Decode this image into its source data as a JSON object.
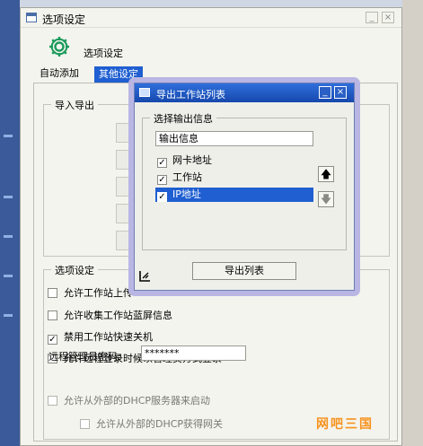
{
  "main_window": {
    "title": "选项设定",
    "header_label": "选项设定",
    "tabs": [
      {
        "label": "自动添加",
        "active": false
      },
      {
        "label": "其他设定",
        "active": true
      }
    ]
  },
  "import_export": {
    "title": "导入导出"
  },
  "options": {
    "title": "选项设定",
    "items": [
      {
        "label": "允许工作站上传",
        "checked": false,
        "enabled": true
      },
      {
        "label": "允许收集工作站蓝屏信息",
        "checked": false,
        "enabled": true
      },
      {
        "label": "禁用工作站快速关机",
        "checked": true,
        "enabled": true
      },
      {
        "label": "允许远程登录时候以管理员方式登录",
        "checked": false,
        "enabled": true
      },
      {
        "label": "允许从外部的DHCP服务器来启动",
        "checked": false,
        "enabled": false
      },
      {
        "label": "允许从外部的DHCP获得网关",
        "checked": false,
        "enabled": false
      }
    ],
    "password_label": "远程管理员密码:",
    "password_value": "*******"
  },
  "dialog": {
    "title": "导出工作站列表",
    "group_title": "选择输出信息",
    "list_header": "输出信息",
    "items": [
      {
        "label": "网卡地址",
        "checked": true,
        "selected": false
      },
      {
        "label": "工作站",
        "checked": true,
        "selected": false
      },
      {
        "label": "IP地址",
        "checked": true,
        "selected": true
      }
    ],
    "export_button": "导出列表",
    "move_up_glyph": "🡅",
    "move_down_glyph": "🡇"
  },
  "watermark": "网吧三国",
  "colors": {
    "selection": "#1f5fd1",
    "dialog_titlebar": "#1648ad",
    "halo": "#b9b6e4",
    "watermark": "#f7931e"
  }
}
